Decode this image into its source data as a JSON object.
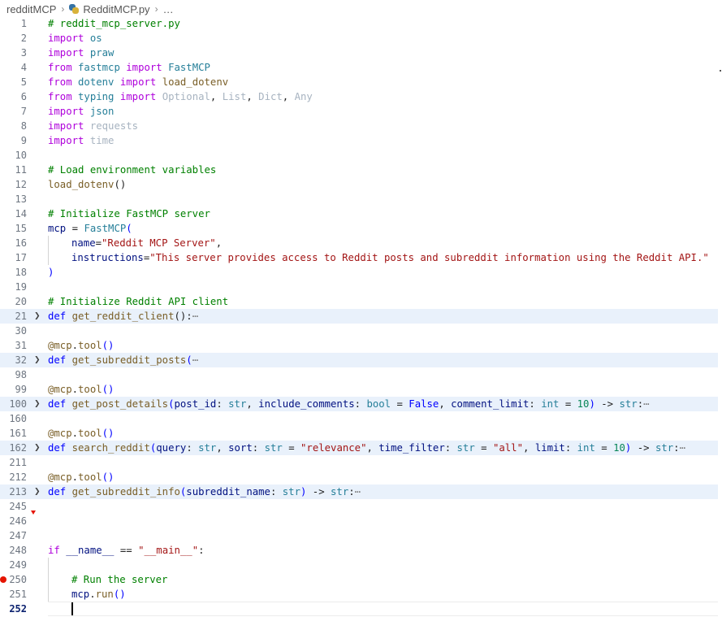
{
  "breadcrumb": {
    "items": [
      {
        "label": "redditMCP"
      },
      {
        "label": "RedditMCP.py"
      },
      {
        "label": "…"
      }
    ]
  },
  "colors": {
    "comment": "#008000",
    "keyword": "#af00db",
    "keyword_blue": "#0000ff",
    "type": "#267f99",
    "function": "#795e26",
    "string": "#a31515",
    "parameter": "#001080",
    "number": "#098658",
    "unused": "#a7b3c0",
    "breakpoint": "#e51400",
    "folded_bg": "#e9f1fb"
  },
  "editor": {
    "current_line": "252",
    "lines": [
      {
        "n": "1",
        "tokens": [
          {
            "t": "# reddit_mcp_server.py",
            "c": "comment"
          }
        ]
      },
      {
        "n": "2",
        "tokens": [
          {
            "t": "import",
            "c": "keyword"
          },
          {
            "t": " "
          },
          {
            "t": "os",
            "c": "module"
          }
        ]
      },
      {
        "n": "3",
        "tokens": [
          {
            "t": "import",
            "c": "keyword"
          },
          {
            "t": " "
          },
          {
            "t": "praw",
            "c": "module"
          }
        ]
      },
      {
        "n": "4",
        "tokens": [
          {
            "t": "from",
            "c": "keyword"
          },
          {
            "t": " "
          },
          {
            "t": "fastmcp",
            "c": "module"
          },
          {
            "t": " "
          },
          {
            "t": "import",
            "c": "keyword"
          },
          {
            "t": " "
          },
          {
            "t": "FastMCP",
            "c": "class"
          }
        ]
      },
      {
        "n": "5",
        "tokens": [
          {
            "t": "from",
            "c": "keyword"
          },
          {
            "t": " "
          },
          {
            "t": "dotenv",
            "c": "module"
          },
          {
            "t": " "
          },
          {
            "t": "import",
            "c": "keyword"
          },
          {
            "t": " "
          },
          {
            "t": "load_dotenv",
            "c": "func"
          }
        ]
      },
      {
        "n": "6",
        "tokens": [
          {
            "t": "from",
            "c": "keyword"
          },
          {
            "t": " "
          },
          {
            "t": "typing",
            "c": "module"
          },
          {
            "t": " "
          },
          {
            "t": "import",
            "c": "keyword"
          },
          {
            "t": " "
          },
          {
            "t": "Optional",
            "c": "dim"
          },
          {
            "t": ", "
          },
          {
            "t": "List",
            "c": "dim"
          },
          {
            "t": ", "
          },
          {
            "t": "Dict",
            "c": "dim"
          },
          {
            "t": ", "
          },
          {
            "t": "Any",
            "c": "dim"
          }
        ]
      },
      {
        "n": "7",
        "tokens": [
          {
            "t": "import",
            "c": "keyword"
          },
          {
            "t": " "
          },
          {
            "t": "json",
            "c": "module"
          }
        ]
      },
      {
        "n": "8",
        "tokens": [
          {
            "t": "import",
            "c": "keyword"
          },
          {
            "t": " "
          },
          {
            "t": "requests",
            "c": "dim"
          }
        ]
      },
      {
        "n": "9",
        "tokens": [
          {
            "t": "import",
            "c": "keyword"
          },
          {
            "t": " "
          },
          {
            "t": "time",
            "c": "dim"
          }
        ]
      },
      {
        "n": "10",
        "tokens": []
      },
      {
        "n": "11",
        "tokens": [
          {
            "t": "# Load environment variables",
            "c": "comment"
          }
        ]
      },
      {
        "n": "12",
        "tokens": [
          {
            "t": "load_dotenv",
            "c": "func"
          },
          {
            "t": "()"
          }
        ]
      },
      {
        "n": "13",
        "tokens": []
      },
      {
        "n": "14",
        "tokens": [
          {
            "t": "# Initialize FastMCP server",
            "c": "comment"
          }
        ]
      },
      {
        "n": "15",
        "tokens": [
          {
            "t": "mcp",
            "c": "param"
          },
          {
            "t": " = "
          },
          {
            "t": "FastMCP",
            "c": "class"
          },
          {
            "t": "(",
            "c": "kwblue"
          }
        ]
      },
      {
        "n": "16",
        "indent": 1,
        "tokens": [
          {
            "t": "name",
            "c": "param"
          },
          {
            "t": "="
          },
          {
            "t": "\"Reddit MCP Server\"",
            "c": "string"
          },
          {
            "t": ","
          }
        ]
      },
      {
        "n": "17",
        "indent": 1,
        "tokens": [
          {
            "t": "instructions",
            "c": "param"
          },
          {
            "t": "="
          },
          {
            "t": "\"This server provides access to Reddit posts and subreddit information using the Reddit API.\"",
            "c": "string"
          }
        ]
      },
      {
        "n": "18",
        "tokens": [
          {
            "t": ")",
            "c": "kwblue"
          }
        ]
      },
      {
        "n": "19",
        "tokens": []
      },
      {
        "n": "20",
        "tokens": [
          {
            "t": "# Initialize Reddit API client",
            "c": "comment"
          }
        ]
      },
      {
        "n": "21",
        "fold": true,
        "tokens": [
          {
            "t": "def",
            "c": "kwblue"
          },
          {
            "t": " "
          },
          {
            "t": "get_reddit_client",
            "c": "func"
          },
          {
            "t": "():"
          },
          {
            "t": "⋯",
            "c": "ellipsis"
          }
        ]
      },
      {
        "n": "30",
        "tokens": []
      },
      {
        "n": "31",
        "tokens": [
          {
            "t": "@mcp",
            "c": "func"
          },
          {
            "t": "."
          },
          {
            "t": "tool",
            "c": "func"
          },
          {
            "t": "()",
            "c": "kwblue"
          }
        ]
      },
      {
        "n": "32",
        "fold": true,
        "tokens": [
          {
            "t": "def",
            "c": "kwblue"
          },
          {
            "t": " "
          },
          {
            "t": "get_subreddit_posts",
            "c": "func"
          },
          {
            "t": "(",
            "c": "kwblue"
          },
          {
            "t": "⋯",
            "c": "ellipsis"
          }
        ]
      },
      {
        "n": "98",
        "tokens": []
      },
      {
        "n": "99",
        "tokens": [
          {
            "t": "@mcp",
            "c": "func"
          },
          {
            "t": "."
          },
          {
            "t": "tool",
            "c": "func"
          },
          {
            "t": "()",
            "c": "kwblue"
          }
        ]
      },
      {
        "n": "100",
        "fold": true,
        "tokens": [
          {
            "t": "def",
            "c": "kwblue"
          },
          {
            "t": " "
          },
          {
            "t": "get_post_details",
            "c": "func"
          },
          {
            "t": "(",
            "c": "kwblue"
          },
          {
            "t": "post_id",
            "c": "param"
          },
          {
            "t": ": "
          },
          {
            "t": "str",
            "c": "class"
          },
          {
            "t": ", "
          },
          {
            "t": "include_comments",
            "c": "param"
          },
          {
            "t": ": "
          },
          {
            "t": "bool",
            "c": "class"
          },
          {
            "t": " = "
          },
          {
            "t": "False",
            "c": "kwblue"
          },
          {
            "t": ", "
          },
          {
            "t": "comment_limit",
            "c": "param"
          },
          {
            "t": ": "
          },
          {
            "t": "int",
            "c": "class"
          },
          {
            "t": " = "
          },
          {
            "t": "10",
            "c": "number"
          },
          {
            "t": ")",
            "c": "kwblue"
          },
          {
            "t": " -> "
          },
          {
            "t": "str",
            "c": "class"
          },
          {
            "t": ":"
          },
          {
            "t": "⋯",
            "c": "ellipsis"
          }
        ]
      },
      {
        "n": "160",
        "tokens": []
      },
      {
        "n": "161",
        "tokens": [
          {
            "t": "@mcp",
            "c": "func"
          },
          {
            "t": "."
          },
          {
            "t": "tool",
            "c": "func"
          },
          {
            "t": "()",
            "c": "kwblue"
          }
        ]
      },
      {
        "n": "162",
        "fold": true,
        "tokens": [
          {
            "t": "def",
            "c": "kwblue"
          },
          {
            "t": " "
          },
          {
            "t": "search_reddit",
            "c": "func"
          },
          {
            "t": "(",
            "c": "kwblue"
          },
          {
            "t": "query",
            "c": "param"
          },
          {
            "t": ": "
          },
          {
            "t": "str",
            "c": "class"
          },
          {
            "t": ", "
          },
          {
            "t": "sort",
            "c": "param"
          },
          {
            "t": ": "
          },
          {
            "t": "str",
            "c": "class"
          },
          {
            "t": " = "
          },
          {
            "t": "\"relevance\"",
            "c": "string"
          },
          {
            "t": ", "
          },
          {
            "t": "time_filter",
            "c": "param"
          },
          {
            "t": ": "
          },
          {
            "t": "str",
            "c": "class"
          },
          {
            "t": " = "
          },
          {
            "t": "\"all\"",
            "c": "string"
          },
          {
            "t": ", "
          },
          {
            "t": "limit",
            "c": "param"
          },
          {
            "t": ": "
          },
          {
            "t": "int",
            "c": "class"
          },
          {
            "t": " = "
          },
          {
            "t": "10",
            "c": "number"
          },
          {
            "t": ")",
            "c": "kwblue"
          },
          {
            "t": " -> "
          },
          {
            "t": "str",
            "c": "class"
          },
          {
            "t": ":"
          },
          {
            "t": "⋯",
            "c": "ellipsis"
          }
        ]
      },
      {
        "n": "211",
        "tokens": []
      },
      {
        "n": "212",
        "tokens": [
          {
            "t": "@mcp",
            "c": "func"
          },
          {
            "t": "."
          },
          {
            "t": "tool",
            "c": "func"
          },
          {
            "t": "()",
            "c": "kwblue"
          }
        ]
      },
      {
        "n": "213",
        "fold": true,
        "tokens": [
          {
            "t": "def",
            "c": "kwblue"
          },
          {
            "t": " "
          },
          {
            "t": "get_subreddit_info",
            "c": "func"
          },
          {
            "t": "(",
            "c": "kwblue"
          },
          {
            "t": "subreddit_name",
            "c": "param"
          },
          {
            "t": ": "
          },
          {
            "t": "str",
            "c": "class"
          },
          {
            "t": ")",
            "c": "kwblue"
          },
          {
            "t": " -> "
          },
          {
            "t": "str",
            "c": "class"
          },
          {
            "t": ":"
          },
          {
            "t": "⋯",
            "c": "ellipsis"
          }
        ]
      },
      {
        "n": "245",
        "tokens": []
      },
      {
        "n": "246",
        "tokens": []
      },
      {
        "n": "247",
        "tokens": []
      },
      {
        "n": "248",
        "tokens": [
          {
            "t": "if",
            "c": "keyword"
          },
          {
            "t": " "
          },
          {
            "t": "__name__",
            "c": "param"
          },
          {
            "t": " == "
          },
          {
            "t": "\"__main__\"",
            "c": "string"
          },
          {
            "t": ":"
          }
        ]
      },
      {
        "n": "249",
        "indent": 1,
        "tokens": []
      },
      {
        "n": "250",
        "indent": 1,
        "breakpoint": true,
        "tokens": [
          {
            "t": "# Run the server",
            "c": "comment"
          }
        ]
      },
      {
        "n": "251",
        "indent": 1,
        "tokens": [
          {
            "t": "mcp",
            "c": "param"
          },
          {
            "t": "."
          },
          {
            "t": "run",
            "c": "func"
          },
          {
            "t": "()",
            "c": "kwblue"
          }
        ]
      },
      {
        "n": "252",
        "tokens": []
      }
    ]
  }
}
